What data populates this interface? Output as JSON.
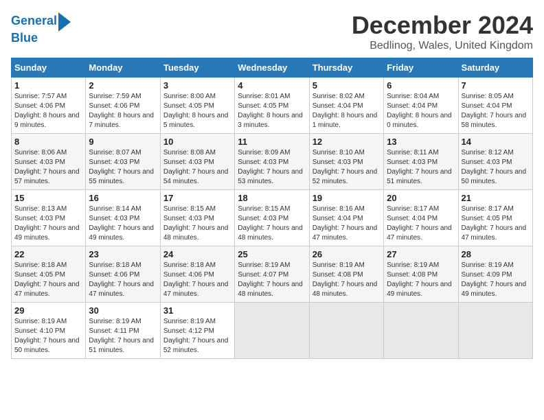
{
  "logo": {
    "line1": "General",
    "line2": "Blue"
  },
  "title": "December 2024",
  "subtitle": "Bedlinog, Wales, United Kingdom",
  "days_of_week": [
    "Sunday",
    "Monday",
    "Tuesday",
    "Wednesday",
    "Thursday",
    "Friday",
    "Saturday"
  ],
  "weeks": [
    [
      {
        "day": 1,
        "sunrise": "7:57 AM",
        "sunset": "4:06 PM",
        "daylight": "8 hours and 9 minutes."
      },
      {
        "day": 2,
        "sunrise": "7:59 AM",
        "sunset": "4:06 PM",
        "daylight": "8 hours and 7 minutes."
      },
      {
        "day": 3,
        "sunrise": "8:00 AM",
        "sunset": "4:05 PM",
        "daylight": "8 hours and 5 minutes."
      },
      {
        "day": 4,
        "sunrise": "8:01 AM",
        "sunset": "4:05 PM",
        "daylight": "8 hours and 3 minutes."
      },
      {
        "day": 5,
        "sunrise": "8:02 AM",
        "sunset": "4:04 PM",
        "daylight": "8 hours and 1 minute."
      },
      {
        "day": 6,
        "sunrise": "8:04 AM",
        "sunset": "4:04 PM",
        "daylight": "8 hours and 0 minutes."
      },
      {
        "day": 7,
        "sunrise": "8:05 AM",
        "sunset": "4:04 PM",
        "daylight": "7 hours and 58 minutes."
      }
    ],
    [
      {
        "day": 8,
        "sunrise": "8:06 AM",
        "sunset": "4:03 PM",
        "daylight": "7 hours and 57 minutes."
      },
      {
        "day": 9,
        "sunrise": "8:07 AM",
        "sunset": "4:03 PM",
        "daylight": "7 hours and 55 minutes."
      },
      {
        "day": 10,
        "sunrise": "8:08 AM",
        "sunset": "4:03 PM",
        "daylight": "7 hours and 54 minutes."
      },
      {
        "day": 11,
        "sunrise": "8:09 AM",
        "sunset": "4:03 PM",
        "daylight": "7 hours and 53 minutes."
      },
      {
        "day": 12,
        "sunrise": "8:10 AM",
        "sunset": "4:03 PM",
        "daylight": "7 hours and 52 minutes."
      },
      {
        "day": 13,
        "sunrise": "8:11 AM",
        "sunset": "4:03 PM",
        "daylight": "7 hours and 51 minutes."
      },
      {
        "day": 14,
        "sunrise": "8:12 AM",
        "sunset": "4:03 PM",
        "daylight": "7 hours and 50 minutes."
      }
    ],
    [
      {
        "day": 15,
        "sunrise": "8:13 AM",
        "sunset": "4:03 PM",
        "daylight": "7 hours and 49 minutes."
      },
      {
        "day": 16,
        "sunrise": "8:14 AM",
        "sunset": "4:03 PM",
        "daylight": "7 hours and 49 minutes."
      },
      {
        "day": 17,
        "sunrise": "8:15 AM",
        "sunset": "4:03 PM",
        "daylight": "7 hours and 48 minutes."
      },
      {
        "day": 18,
        "sunrise": "8:15 AM",
        "sunset": "4:03 PM",
        "daylight": "7 hours and 48 minutes."
      },
      {
        "day": 19,
        "sunrise": "8:16 AM",
        "sunset": "4:04 PM",
        "daylight": "7 hours and 47 minutes."
      },
      {
        "day": 20,
        "sunrise": "8:17 AM",
        "sunset": "4:04 PM",
        "daylight": "7 hours and 47 minutes."
      },
      {
        "day": 21,
        "sunrise": "8:17 AM",
        "sunset": "4:05 PM",
        "daylight": "7 hours and 47 minutes."
      }
    ],
    [
      {
        "day": 22,
        "sunrise": "8:18 AM",
        "sunset": "4:05 PM",
        "daylight": "7 hours and 47 minutes."
      },
      {
        "day": 23,
        "sunrise": "8:18 AM",
        "sunset": "4:06 PM",
        "daylight": "7 hours and 47 minutes."
      },
      {
        "day": 24,
        "sunrise": "8:18 AM",
        "sunset": "4:06 PM",
        "daylight": "7 hours and 47 minutes."
      },
      {
        "day": 25,
        "sunrise": "8:19 AM",
        "sunset": "4:07 PM",
        "daylight": "7 hours and 48 minutes."
      },
      {
        "day": 26,
        "sunrise": "8:19 AM",
        "sunset": "4:08 PM",
        "daylight": "7 hours and 48 minutes."
      },
      {
        "day": 27,
        "sunrise": "8:19 AM",
        "sunset": "4:08 PM",
        "daylight": "7 hours and 49 minutes."
      },
      {
        "day": 28,
        "sunrise": "8:19 AM",
        "sunset": "4:09 PM",
        "daylight": "7 hours and 49 minutes."
      }
    ],
    [
      {
        "day": 29,
        "sunrise": "8:19 AM",
        "sunset": "4:10 PM",
        "daylight": "7 hours and 50 minutes."
      },
      {
        "day": 30,
        "sunrise": "8:19 AM",
        "sunset": "4:11 PM",
        "daylight": "7 hours and 51 minutes."
      },
      {
        "day": 31,
        "sunrise": "8:19 AM",
        "sunset": "4:12 PM",
        "daylight": "7 hours and 52 minutes."
      },
      null,
      null,
      null,
      null
    ]
  ]
}
